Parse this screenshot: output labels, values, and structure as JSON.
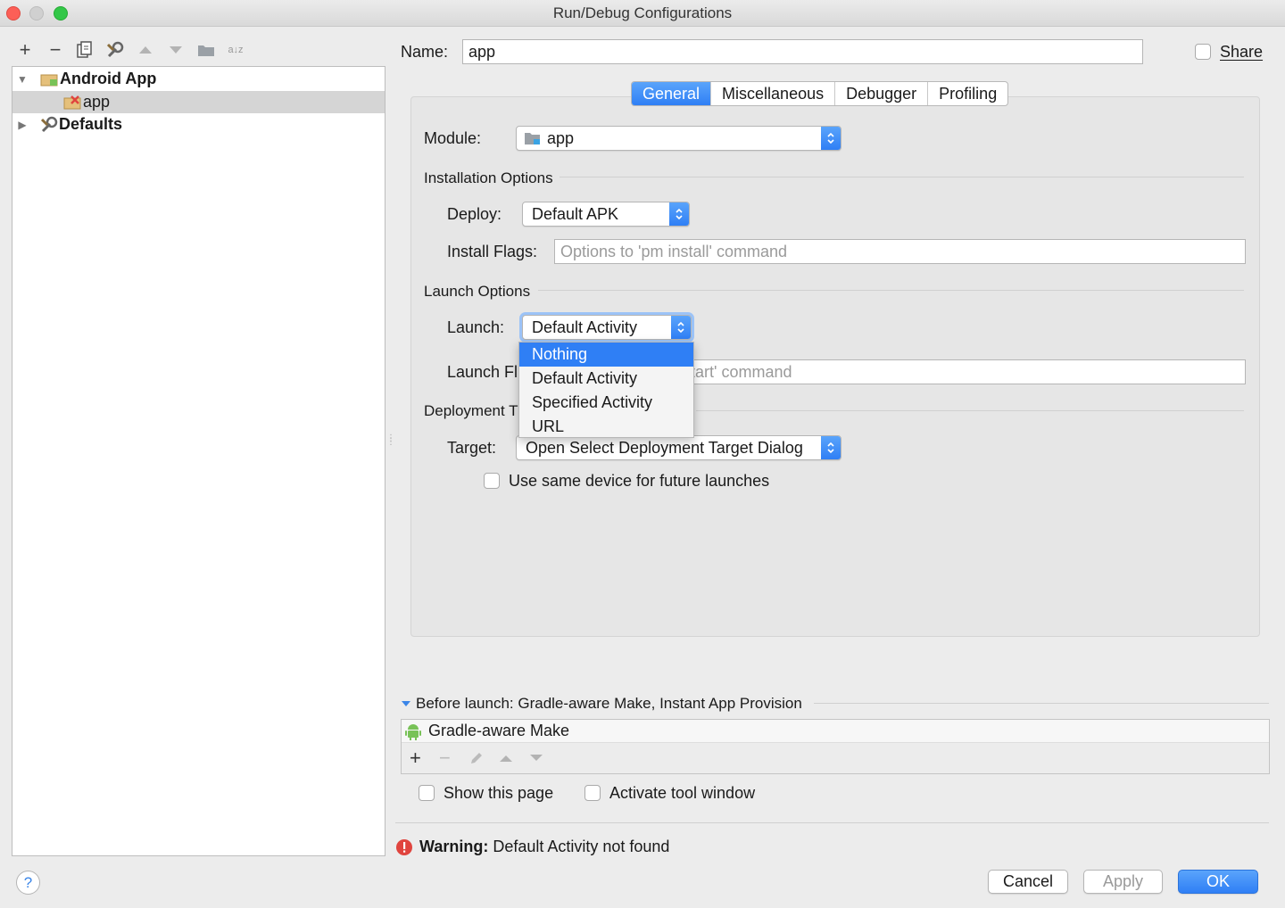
{
  "window": {
    "title": "Run/Debug Configurations"
  },
  "toolbar": {
    "add": "+",
    "remove": "−",
    "sort_icon_text": "a↓z"
  },
  "tree": {
    "items": [
      {
        "label": "Android App",
        "expanded": true
      },
      {
        "label": "app",
        "selected": true
      },
      {
        "label": "Defaults",
        "expanded": false
      }
    ]
  },
  "name_field": {
    "label": "Name:",
    "value": "app"
  },
  "share": {
    "label": "Share",
    "checked": false
  },
  "tabs": [
    {
      "label": "General",
      "active": true
    },
    {
      "label": "Miscellaneous",
      "active": false
    },
    {
      "label": "Debugger",
      "active": false
    },
    {
      "label": "Profiling",
      "active": false
    }
  ],
  "general": {
    "module_label": "Module:",
    "module_value": "app",
    "installation_options": "Installation Options",
    "deploy_label": "Deploy:",
    "deploy_value": "Default APK",
    "install_flags_label": "Install Flags:",
    "install_flags_placeholder": "Options to 'pm install' command",
    "launch_options": "Launch Options",
    "launch_label": "Launch:",
    "launch_value": "Default Activity",
    "launch_flags_label": "Launch Fl",
    "launch_flags_placeholder_visible": "tart' command",
    "deployment_target_label": "Deployment T",
    "target_label": "Target:",
    "target_value": "Open Select Deployment Target Dialog",
    "same_device_label": "Use same device for future launches",
    "same_device_checked": false
  },
  "launch_dropdown": {
    "options": [
      "Nothing",
      "Default Activity",
      "Specified Activity",
      "URL"
    ],
    "highlighted": "Nothing"
  },
  "before_launch": {
    "header": "Before launch: Gradle-aware Make, Instant App Provision",
    "tasks": [
      "Gradle-aware Make"
    ],
    "show_page_label": "Show this page",
    "activate_tool_window_label": "Activate tool window"
  },
  "warning": {
    "bold": "Warning:",
    "text": "Default Activity not found"
  },
  "buttons": {
    "help": "?",
    "cancel": "Cancel",
    "apply": "Apply",
    "ok": "OK"
  },
  "colors": {
    "accent": "#2f7ff5",
    "warning": "#e0443e",
    "android_green": "#78c257"
  }
}
